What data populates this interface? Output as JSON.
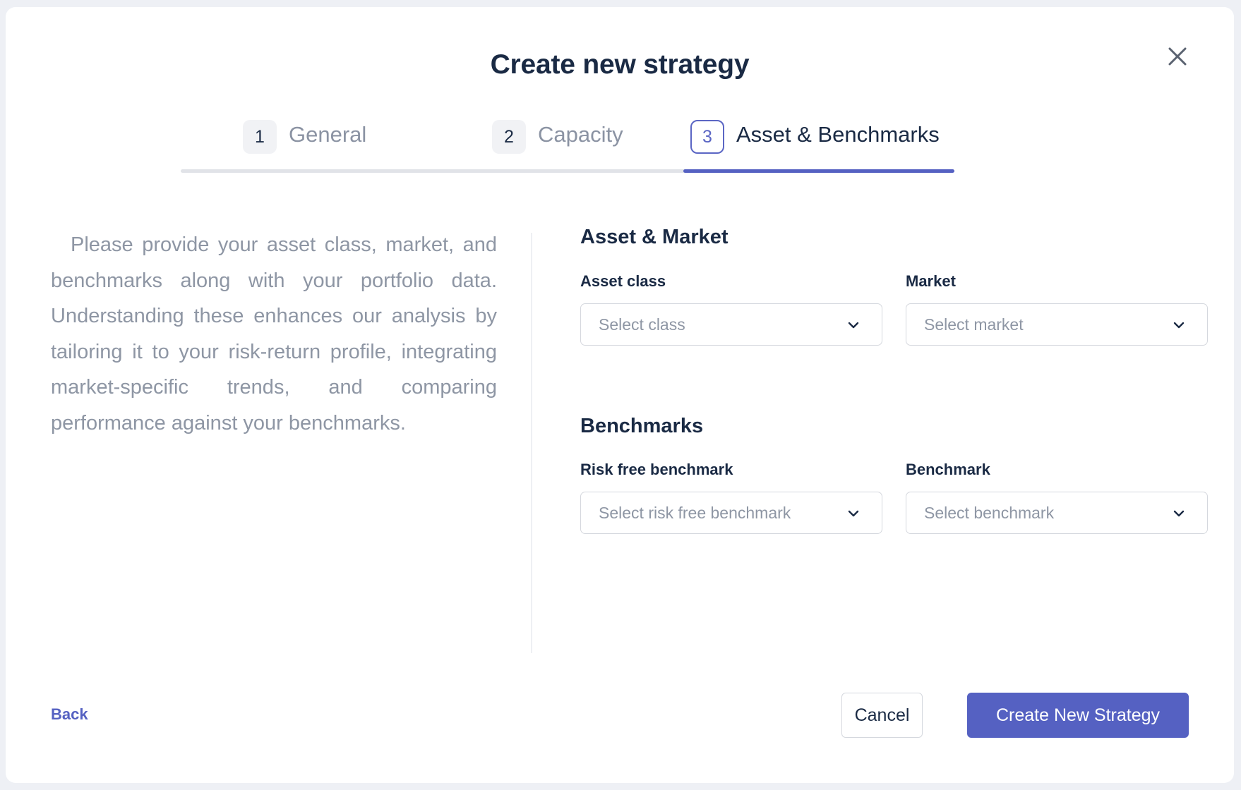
{
  "modal": {
    "title": "Create new strategy"
  },
  "steps": [
    {
      "number": "1",
      "label": "General",
      "active": false
    },
    {
      "number": "2",
      "label": "Capacity",
      "active": false
    },
    {
      "number": "3",
      "label": "Asset & Benchmarks",
      "active": true
    }
  ],
  "description": "Please provide your asset class, market, and benchmarks along with your portfolio data. Understanding these enhances our analysis by tailoring it to your risk-return profile, integrating market-specific trends, and comparing performance against your benchmarks.",
  "asset_market": {
    "title": "Asset & Market",
    "asset_class": {
      "label": "Asset class",
      "placeholder": "Select class"
    },
    "market": {
      "label": "Market",
      "placeholder": "Select market"
    }
  },
  "benchmarks": {
    "title": "Benchmarks",
    "risk_free": {
      "label": "Risk free benchmark",
      "placeholder": "Select risk free benchmark"
    },
    "benchmark": {
      "label": "Benchmark",
      "placeholder": "Select benchmark"
    }
  },
  "footer": {
    "back_label": "Back",
    "cancel_label": "Cancel",
    "create_label": "Create New Strategy"
  },
  "icons": {
    "close": "close-icon",
    "dropdown": "chevron-down-icon"
  },
  "colors": {
    "accent": "#5561c2",
    "title_text": "#1a2a44",
    "muted_text": "#8e96a4"
  }
}
